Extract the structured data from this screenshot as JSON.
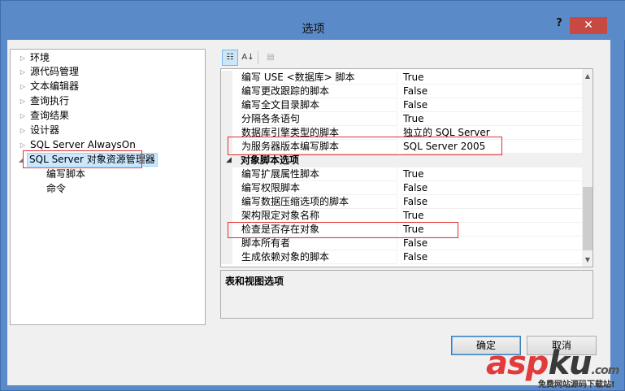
{
  "window": {
    "title": "选项",
    "help": "?",
    "close": "✕"
  },
  "tree": {
    "items": [
      {
        "label": "环境",
        "arrow": "▷"
      },
      {
        "label": "源代码管理",
        "arrow": "▷"
      },
      {
        "label": "文本编辑器",
        "arrow": "▷"
      },
      {
        "label": "查询执行",
        "arrow": "▷"
      },
      {
        "label": "查询结果",
        "arrow": "▷"
      },
      {
        "label": "设计器",
        "arrow": "▷"
      },
      {
        "label": "SQL Server AlwaysOn",
        "arrow": "▷"
      },
      {
        "label": "SQL Server 对象资源管理器",
        "arrow": "◢"
      },
      {
        "label": "编写脚本"
      },
      {
        "label": "命令"
      }
    ]
  },
  "toolbar": {
    "categorized": "☷",
    "alphabetical": "A↓",
    "pages": "▤"
  },
  "grid": {
    "rows_top": [
      {
        "name": "编写 USE <数据库> 脚本",
        "value": "True"
      },
      {
        "name": "编写更改跟踪的脚本",
        "value": "False"
      },
      {
        "name": "编写全文目录脚本",
        "value": "False"
      },
      {
        "name": "分隔各条语句",
        "value": "True"
      },
      {
        "name": "数据库引擎类型的脚本",
        "value": "独立的 SQL Server"
      },
      {
        "name": "为服务器版本编写脚本",
        "value": "SQL Server 2005"
      }
    ],
    "category": {
      "label": "对象脚本选项",
      "arrow": "◢"
    },
    "rows_bottom": [
      {
        "name": "编写扩展属性脚本",
        "value": "True"
      },
      {
        "name": "编写权限脚本",
        "value": "False"
      },
      {
        "name": "编写数据压缩选项的脚本",
        "value": "False"
      },
      {
        "name": "架构限定对象名称",
        "value": "True"
      },
      {
        "name": "检查是否存在对象",
        "value": "True"
      },
      {
        "name": "脚本所有者",
        "value": "False"
      },
      {
        "name": "生成依赖对象的脚本",
        "value": "False"
      }
    ],
    "scroll_up": "▲",
    "scroll_down": "▼"
  },
  "description": {
    "title": "表和视图选项"
  },
  "buttons": {
    "ok": "确定",
    "cancel": "取消"
  },
  "watermark": {
    "logo_main": "asp",
    "logo_accent": "ku",
    "logo_suffix": ".com",
    "tagline": "免费网站源码下载站!"
  }
}
